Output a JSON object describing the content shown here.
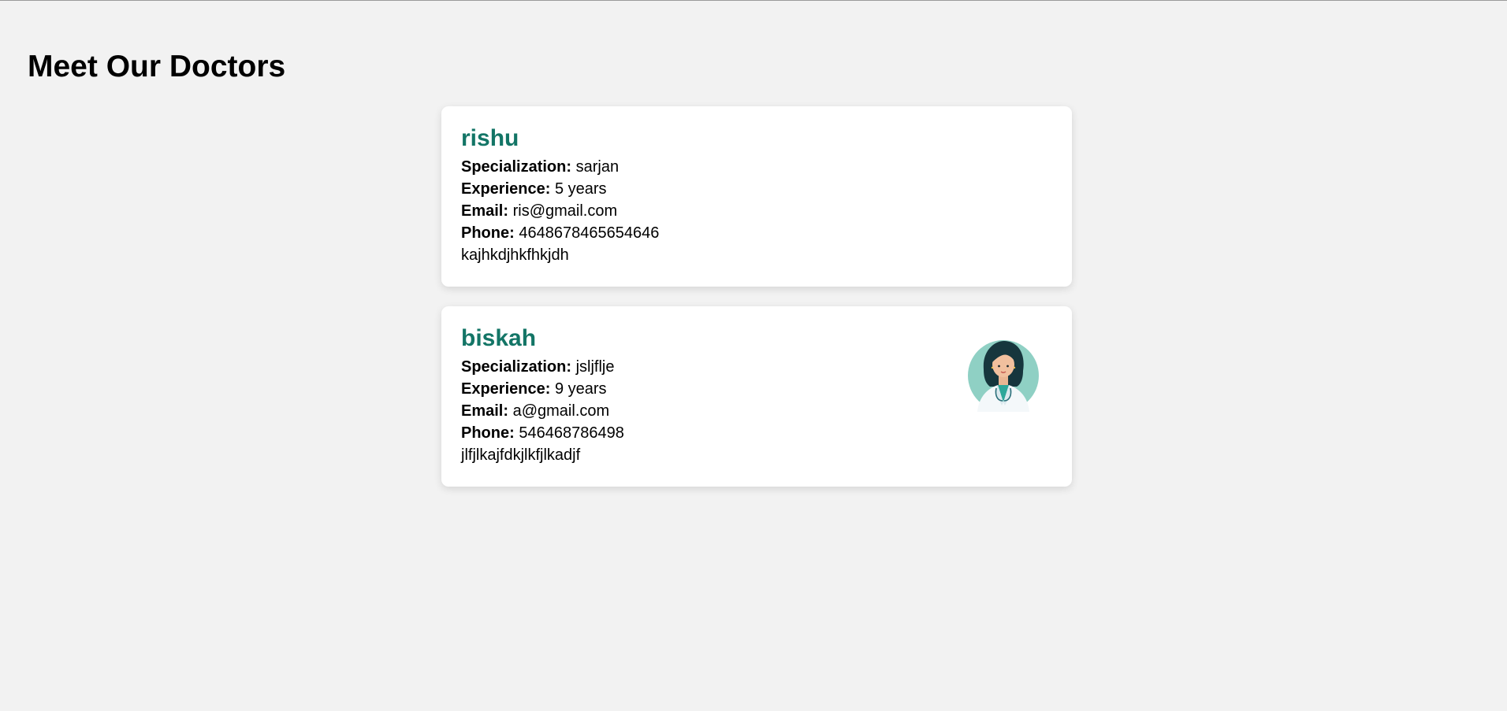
{
  "page": {
    "title": "Meet Our Doctors"
  },
  "labels": {
    "specialization": "Specialization:",
    "experience": "Experience:",
    "email": "Email:",
    "phone": "Phone:"
  },
  "doctors": [
    {
      "name": "rishu",
      "specialization": "sarjan",
      "experience": "5 years",
      "email": "ris@gmail.com",
      "phone": "4648678465654646",
      "description": "kajhkdjhkfhkjdh",
      "has_avatar": false
    },
    {
      "name": "biskah",
      "specialization": "jsljflje",
      "experience": "9 years",
      "email": "a@gmail.com",
      "phone": "546468786498",
      "description": "jlfjlkajfdkjlkfjlkadjf",
      "has_avatar": true,
      "avatar_icon": "female-doctor-avatar"
    }
  ],
  "colors": {
    "background": "#f2f2f2",
    "card": "#ffffff",
    "doctor_name": "#137566",
    "avatar_circle": "#8fd0c4"
  }
}
